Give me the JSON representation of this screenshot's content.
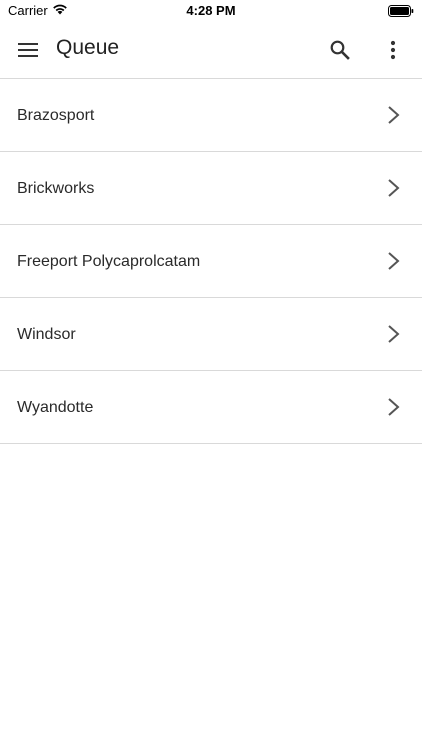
{
  "status_bar": {
    "carrier": "Carrier",
    "time": "4:28 PM"
  },
  "app_bar": {
    "title": "Queue",
    "menu_icon": "hamburger-menu-icon",
    "search_icon": "search-icon",
    "more_icon": "more-vert-icon"
  },
  "list": {
    "items": [
      {
        "label": "Brazosport"
      },
      {
        "label": "Brickworks"
      },
      {
        "label": "Freeport Polycaprolcatam"
      },
      {
        "label": "Windsor"
      },
      {
        "label": "Wyandotte"
      }
    ]
  },
  "colors": {
    "text": "#222222",
    "divider": "#d9d9d9",
    "icon": "#333333",
    "chevron": "#555555"
  }
}
